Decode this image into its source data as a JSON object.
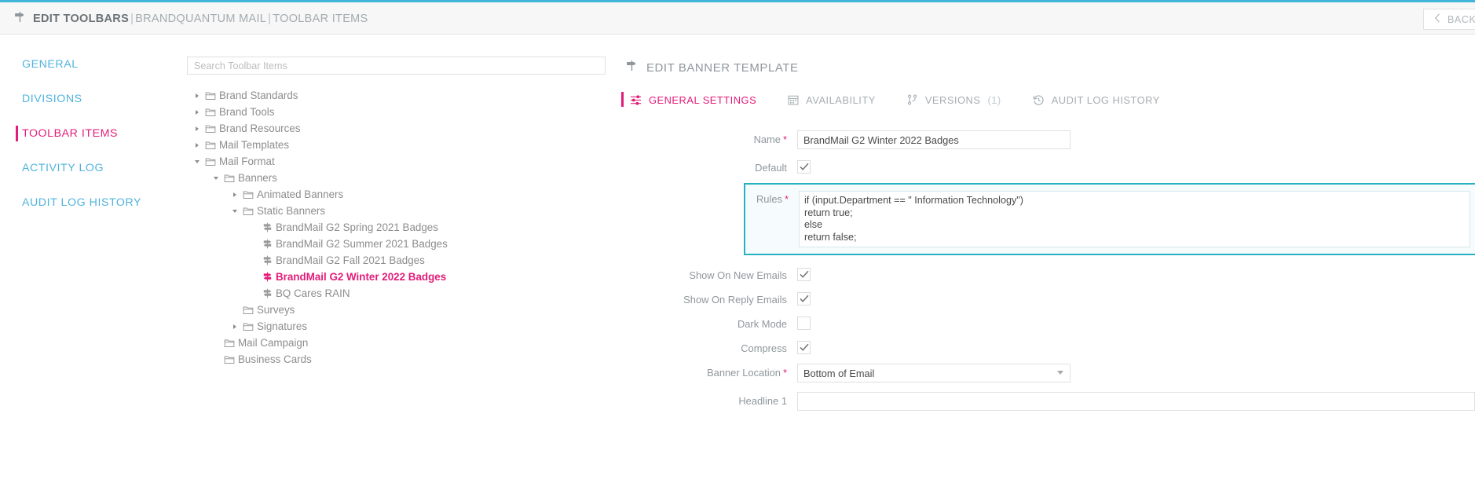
{
  "topbar": {
    "crumb_icon": "signpost-icon",
    "crumb_0": "EDIT TOOLBARS",
    "sep": "|",
    "crumb_1": "BRANDQUANTUM MAIL",
    "crumb_2": "TOOLBAR ITEMS",
    "back_label": "BACK",
    "back_icon": "chevron-left-icon",
    "accent_top": "#41b6d9"
  },
  "sidebar": {
    "items": [
      {
        "label": "GENERAL",
        "active": false
      },
      {
        "label": "DIVISIONS",
        "active": false
      },
      {
        "label": "TOOLBAR ITEMS",
        "active": true
      },
      {
        "label": "ACTIVITY LOG",
        "active": false
      },
      {
        "label": "AUDIT LOG HISTORY",
        "active": false
      }
    ],
    "link_color": "#4fb3dd",
    "active_color": "#e31c79"
  },
  "search": {
    "placeholder": "Search Toolbar Items",
    "value": ""
  },
  "tree": {
    "nodes": [
      {
        "label": "Brand Standards",
        "depth": 0,
        "state": "collapsed",
        "icon": "folder-icon",
        "selected": false
      },
      {
        "label": "Brand Tools",
        "depth": 0,
        "state": "collapsed",
        "icon": "folder-icon",
        "selected": false
      },
      {
        "label": "Brand Resources",
        "depth": 0,
        "state": "collapsed",
        "icon": "folder-icon",
        "selected": false
      },
      {
        "label": "Mail Templates",
        "depth": 0,
        "state": "collapsed",
        "icon": "folder-icon",
        "selected": false
      },
      {
        "label": "Mail Format",
        "depth": 0,
        "state": "expanded",
        "icon": "folder-icon",
        "selected": false
      },
      {
        "label": "Banners",
        "depth": 1,
        "state": "expanded",
        "icon": "folder-icon",
        "selected": false
      },
      {
        "label": "Animated Banners",
        "depth": 2,
        "state": "collapsed",
        "icon": "folder-icon",
        "selected": false
      },
      {
        "label": "Static Banners",
        "depth": 2,
        "state": "expanded",
        "icon": "folder-icon",
        "selected": false
      },
      {
        "label": "BrandMail G2 Spring 2021 Badges",
        "depth": 3,
        "state": "leaf",
        "icon": "signpost-icon",
        "selected": false
      },
      {
        "label": "BrandMail G2 Summer 2021 Badges",
        "depth": 3,
        "state": "leaf",
        "icon": "signpost-icon",
        "selected": false
      },
      {
        "label": "BrandMail G2 Fall 2021 Badges",
        "depth": 3,
        "state": "leaf",
        "icon": "signpost-icon",
        "selected": false
      },
      {
        "label": "BrandMail G2 Winter 2022 Badges",
        "depth": 3,
        "state": "leaf",
        "icon": "signpost-icon",
        "selected": true
      },
      {
        "label": "BQ Cares RAIN",
        "depth": 3,
        "state": "leaf",
        "icon": "signpost-icon",
        "selected": false
      },
      {
        "label": "Surveys",
        "depth": 2,
        "state": "leaf",
        "icon": "folder-icon",
        "selected": false
      },
      {
        "label": "Signatures",
        "depth": 2,
        "state": "collapsed",
        "icon": "folder-icon",
        "selected": false
      },
      {
        "label": "Mail Campaign",
        "depth": 1,
        "state": "leaf",
        "icon": "folder-icon",
        "selected": false
      },
      {
        "label": "Business Cards",
        "depth": 1,
        "state": "leaf",
        "icon": "folder-icon",
        "selected": false
      }
    ]
  },
  "pane": {
    "title": "EDIT BANNER TEMPLATE",
    "title_icon": "signpost-icon",
    "tabs": [
      {
        "label": "GENERAL SETTINGS",
        "icon": "sliders-icon",
        "count": "",
        "active": true
      },
      {
        "label": "AVAILABILITY",
        "icon": "calendar-icon",
        "count": "",
        "active": false
      },
      {
        "label": "VERSIONS",
        "icon": "branch-icon",
        "count": "(1)",
        "active": false
      },
      {
        "label": "AUDIT LOG HISTORY",
        "icon": "history-icon",
        "count": "",
        "active": false
      }
    ]
  },
  "form": {
    "name": {
      "label": "Name",
      "required": true,
      "value": "BrandMail G2 Winter 2022 Badges"
    },
    "default": {
      "label": "Default",
      "checked": true
    },
    "rules": {
      "label": "Rules",
      "required": true,
      "value": "if (input.Department == \" Information Technology\")\nreturn true;\nelse\nreturn false;",
      "focused": true,
      "focus_color": "#27b2c4"
    },
    "show_on_new_emails": {
      "label": "Show On New Emails",
      "checked": true
    },
    "show_on_reply_emails": {
      "label": "Show On Reply Emails",
      "checked": true
    },
    "dark_mode": {
      "label": "Dark Mode",
      "checked": false
    },
    "compress": {
      "label": "Compress",
      "checked": true
    },
    "banner_location": {
      "label": "Banner Location",
      "required": true,
      "value": "Bottom of Email"
    },
    "headline_1": {
      "label": "Headline 1",
      "required": false,
      "value": ""
    }
  }
}
